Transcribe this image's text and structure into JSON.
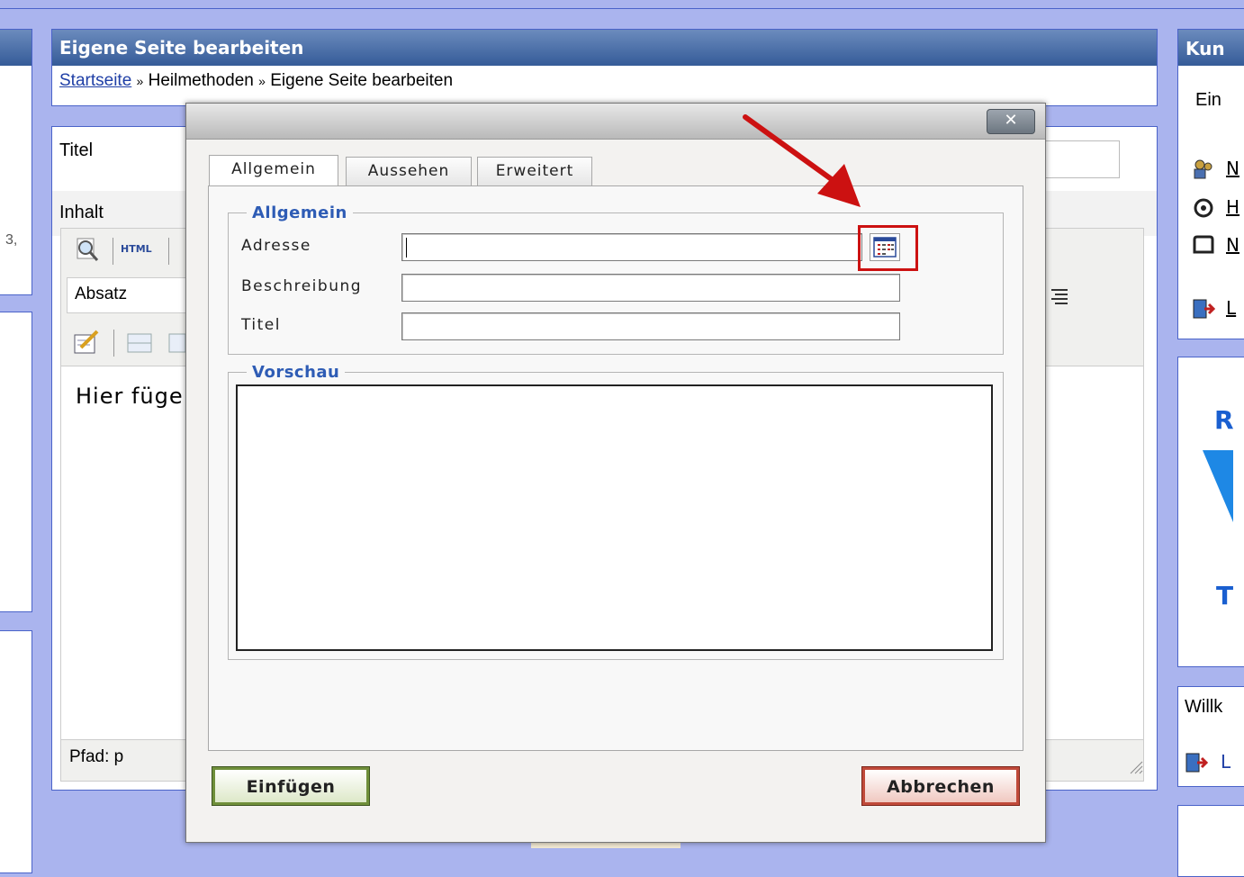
{
  "page": {
    "header_title": "Eigene Seite bearbeiten",
    "breadcrumb": {
      "home": "Startseite",
      "sep1": "»",
      "section": "Heilmethoden",
      "sep2": "»",
      "current": "Eigene Seite bearbeiten"
    },
    "title_label": "Titel",
    "content_label": "Inhalt",
    "left_fragment": "3,",
    "editor": {
      "html_button": "HTML",
      "format_select": "Absatz",
      "body_text": "Hier füge",
      "status_path": "Pfad: p"
    }
  },
  "sidebar": {
    "box1_header": "Kun",
    "box1_text": "Ein",
    "link1": "N",
    "link2": "H",
    "link3": "N",
    "link4": "L",
    "ad_text_top": "R",
    "ad_text_bottom": "T",
    "welcome_text": "Willk",
    "welcome_link": "L"
  },
  "dialog": {
    "close_glyph": "✕",
    "tabs": [
      {
        "label": "Allgemein",
        "active": true
      },
      {
        "label": "Aussehen",
        "active": false
      },
      {
        "label": "Erweitert",
        "active": false
      }
    ],
    "general_legend": "Allgemein",
    "fields": {
      "address_label": "Adresse",
      "address_value": "",
      "description_label": "Beschreibung",
      "description_value": "",
      "title_label": "Titel",
      "title_value": ""
    },
    "preview_legend": "Vorschau",
    "insert_button": "Einfügen",
    "cancel_button": "Abbrechen"
  },
  "colors": {
    "page_bg": "#aab4ee",
    "header_blue": "#355b98",
    "legend_blue": "#2e5cb5",
    "annotation_red": "#cc1111",
    "link_blue": "#1f3fa6"
  }
}
